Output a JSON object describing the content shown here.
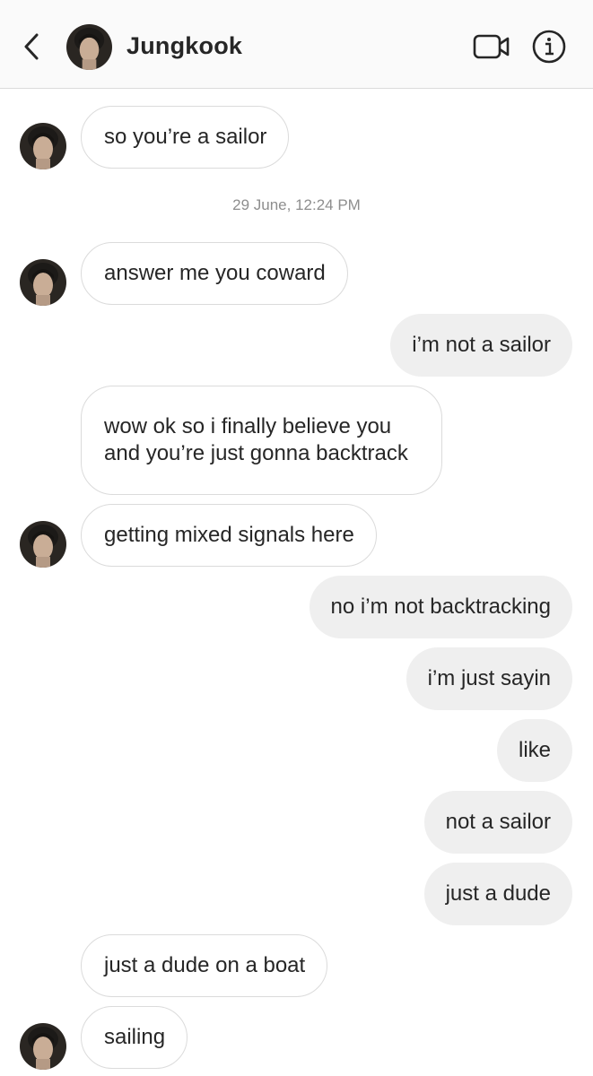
{
  "header": {
    "contact_name": "Jungkook",
    "icons": {
      "back": "chevron-left-icon",
      "video": "video-call-icon",
      "info": "info-icon"
    }
  },
  "timestamp": "29 June, 12:24 PM",
  "messages": [
    {
      "sender": "them",
      "text": "so you’re a sailor",
      "avatar": true
    },
    {
      "sender": "them",
      "text": "answer me you coward",
      "avatar": true
    },
    {
      "sender": "me",
      "text": "i’m not a sailor"
    },
    {
      "sender": "them",
      "text": "wow ok so i finally believe you and you’re just gonna backtrack",
      "avatar": false
    },
    {
      "sender": "them",
      "text": "getting mixed signals here",
      "avatar": true
    },
    {
      "sender": "me",
      "text": "no i’m not backtracking"
    },
    {
      "sender": "me",
      "text": "i’m just sayin"
    },
    {
      "sender": "me",
      "text": "like"
    },
    {
      "sender": "me",
      "text": "not a sailor"
    },
    {
      "sender": "me",
      "text": "just a dude"
    },
    {
      "sender": "them",
      "text": "just a dude on a boat",
      "avatar": false
    },
    {
      "sender": "them",
      "text": "sailing",
      "avatar": true
    }
  ],
  "colors": {
    "header_bg": "#fafafa",
    "outgoing_bubble": "#efefef",
    "incoming_border": "#dbdbdb",
    "text": "#262626",
    "timestamp": "#8e8e8e"
  }
}
